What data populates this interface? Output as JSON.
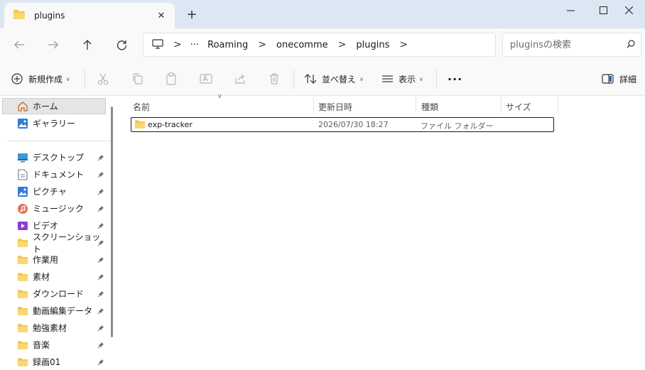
{
  "window": {
    "tab_title": "plugins",
    "tab_close_glyph": "✕",
    "new_tab_glyph": "+",
    "minimize_glyph": "—",
    "maximize_glyph": "☐",
    "close_glyph": "✕"
  },
  "address": {
    "ellipsis": "···",
    "breadcrumbs": [
      "Roaming",
      "onecomme",
      "plugins"
    ],
    "separator": ">"
  },
  "search": {
    "placeholder": "pluginsの検索"
  },
  "toolbar": {
    "new_label": "新規作成",
    "sort_label": "並べ替え",
    "view_label": "表示",
    "more_label": "···",
    "details_label": "詳細"
  },
  "sidebar": {
    "home": "ホーム",
    "gallery": "ギャラリー",
    "items": [
      {
        "label": "デスクトップ",
        "icon": "desktop-icon"
      },
      {
        "label": "ドキュメント",
        "icon": "documents-icon"
      },
      {
        "label": "ピクチャ",
        "icon": "pictures-icon"
      },
      {
        "label": "ミュージック",
        "icon": "music-icon"
      },
      {
        "label": "ビデオ",
        "icon": "videos-icon"
      },
      {
        "label": "スクリーンショット",
        "icon": "folder-icon"
      },
      {
        "label": "作業用",
        "icon": "folder-icon"
      },
      {
        "label": "素材",
        "icon": "folder-icon"
      },
      {
        "label": "ダウンロード",
        "icon": "folder-icon"
      },
      {
        "label": "動画編集データ",
        "icon": "folder-icon"
      },
      {
        "label": "勉強素材",
        "icon": "folder-icon"
      },
      {
        "label": "音楽",
        "icon": "folder-icon"
      },
      {
        "label": "録画01",
        "icon": "folder-icon"
      }
    ]
  },
  "columns": {
    "name": "名前",
    "modified": "更新日時",
    "type": "種類",
    "size": "サイズ"
  },
  "files": [
    {
      "name": "exp-tracker",
      "modified": "2026/07/30 18:27",
      "type": "ファイル フォルダー",
      "size": ""
    }
  ],
  "colors": {
    "titlebar": "#dce7f3",
    "chrome": "#f9f9f9",
    "folder": "#f3c646",
    "accent": "#0067c0"
  }
}
